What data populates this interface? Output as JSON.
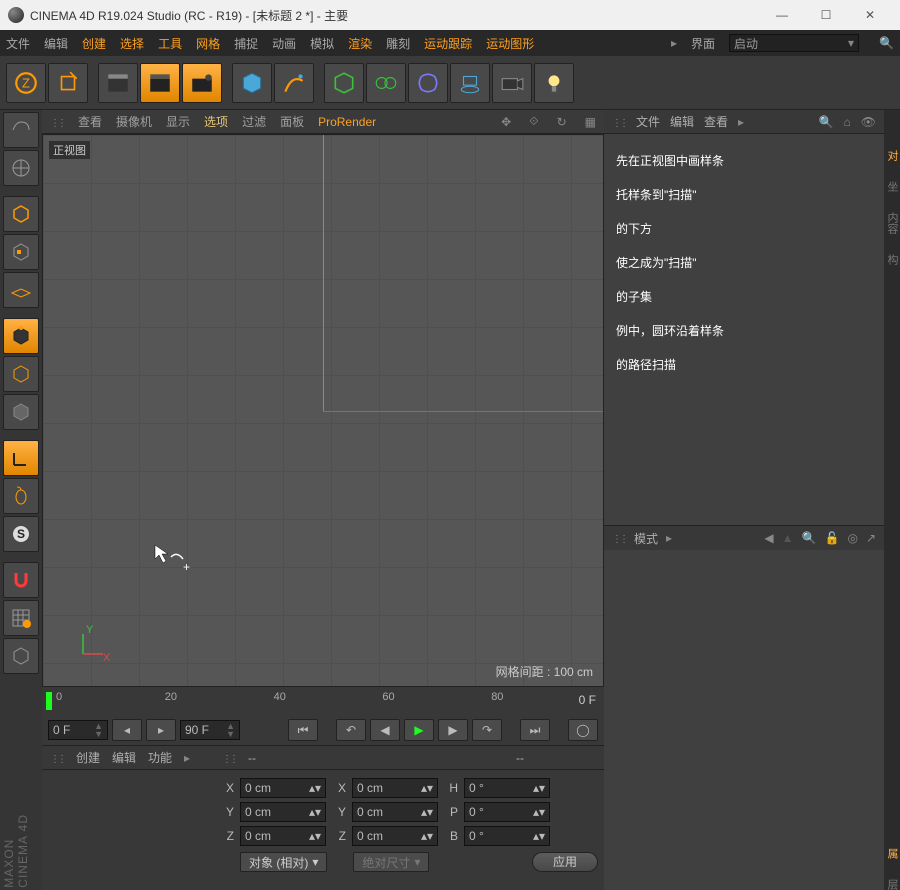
{
  "window": {
    "title": "CINEMA 4D R19.024 Studio (RC - R19) - [未标题 2 *] - 主要"
  },
  "menubar": {
    "items": [
      "文件",
      "编辑",
      "创建",
      "选择",
      "工具",
      "网格",
      "捕捉",
      "动画",
      "模拟",
      "渲染",
      "雕刻",
      "运动跟踪",
      "运动图形"
    ],
    "highlightIdx": [
      2,
      3,
      4,
      5
    ],
    "layoutLabel": "界面",
    "layoutValue": "启动"
  },
  "viewmenu": {
    "items": [
      "查看",
      "摄像机",
      "显示",
      "选项",
      "过滤",
      "面板",
      "ProRender"
    ],
    "selected": "选项",
    "highlight": "ProRender"
  },
  "viewport": {
    "label": "正视图",
    "gridText": "网格间距 : 100 cm",
    "axisY": "Y",
    "axisX": "X"
  },
  "timeline": {
    "ticks": [
      "0",
      "20",
      "40",
      "60",
      "80"
    ],
    "endLabel": "0 F",
    "startField": "0 F",
    "endField": "90 F"
  },
  "attr": {
    "menus": [
      "创建",
      "编辑",
      "功能"
    ],
    "dashes": "--",
    "rows": [
      {
        "l": "X",
        "v": "0 cm",
        "l2": "X",
        "v2": "0 cm",
        "l3": "H",
        "v3": "0 °"
      },
      {
        "l": "Y",
        "v": "0 cm",
        "l2": "Y",
        "v2": "0 cm",
        "l3": "P",
        "v3": "0 °"
      },
      {
        "l": "Z",
        "v": "0 cm",
        "l2": "Z",
        "v2": "0 cm",
        "l3": "B",
        "v3": "0 °"
      }
    ],
    "sel1": "对象 (相对)",
    "sel2": "绝对尺寸",
    "apply": "应用"
  },
  "objmenu": {
    "items": [
      "文件",
      "编辑",
      "查看"
    ]
  },
  "tutorial": {
    "l1": "先在正视图中画样条",
    "l2": "托样条到\"扫描\"",
    "l3": "的下方",
    "l4": "使之成为\"扫描\"",
    "l5": "的子集",
    "l6": "例中，圆环沿着样条",
    "l7": "的路径扫描"
  },
  "mode": {
    "label": "模式"
  },
  "logo": {
    "brand": "MAXON",
    "prod": "CINEMA 4D"
  }
}
